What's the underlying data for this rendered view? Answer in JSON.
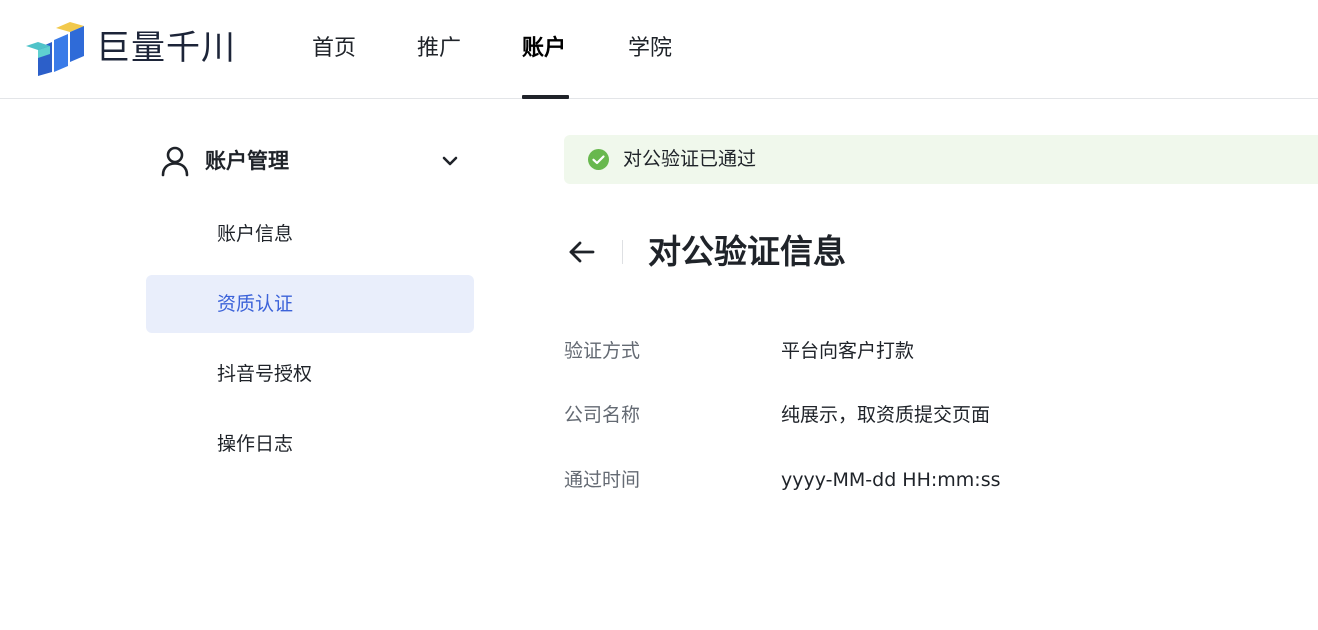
{
  "header": {
    "logo_text": "巨量千川",
    "nav": [
      {
        "label": "首页",
        "active": false
      },
      {
        "label": "推广",
        "active": false
      },
      {
        "label": "账户",
        "active": true
      },
      {
        "label": "学院",
        "active": false
      }
    ]
  },
  "sidebar": {
    "group_label": "账户管理",
    "group_icon": "user-icon",
    "items": [
      {
        "label": "账户信息",
        "active": false
      },
      {
        "label": "资质认证",
        "active": true
      },
      {
        "label": "抖音号授权",
        "active": false
      },
      {
        "label": "操作日志",
        "active": false
      }
    ]
  },
  "main": {
    "alert_text": "对公验证已通过",
    "title": "对公验证信息",
    "fields": [
      {
        "label": "验证方式",
        "value": "平台向客户打款"
      },
      {
        "label": "公司名称",
        "value": "纯展示，取资质提交页面"
      },
      {
        "label": "通过时间",
        "value": "yyyy-MM-dd HH:mm:ss"
      }
    ]
  },
  "colors": {
    "accent": "#3c63d9",
    "active_bg": "#e9eefb",
    "success": "#68b84e",
    "alert_bg": "#f0f8ec"
  }
}
